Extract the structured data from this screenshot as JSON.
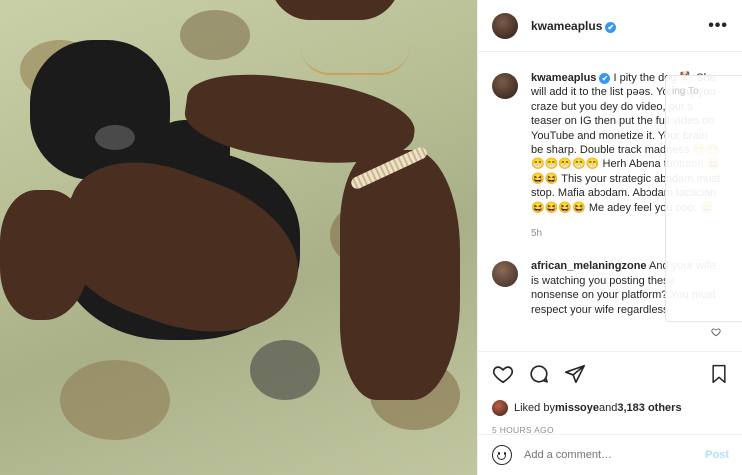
{
  "header": {
    "username": "kwameaplus",
    "verified_glyph": "✔",
    "more_icon": "more-horizontal-icon",
    "more_label": "•••"
  },
  "caption": {
    "username": "kwameaplus",
    "text": " I pity the dog 🐕 She will add it to the list pəəs. You say you craze but you dey do video, put a teaser on IG then put the full video on YouTube and monetize it. Your brain be sharp. Double track madness 😁😁😁😁😁😁😁 Herh Abena tuntum!! 😆😆😆 This your strategic abɔdam must stop. Mafia abɔdam. Abɔdam tactician 😆😆😆😆 Me adey feel you ooo. 😅",
    "time": "5h"
  },
  "comment": {
    "username": "african_melaningzone",
    "text": " And your wife is watching you posting these nonsense on your platform? You must respect your wife regardless"
  },
  "overlay": {
    "ghost_text": "ing To"
  },
  "actions": {
    "like_icon": "heart-icon",
    "comment_icon": "comment-icon",
    "share_icon": "share-icon",
    "save_icon": "bookmark-icon"
  },
  "likes": {
    "prefix": "Liked by ",
    "user": "missoye",
    "middle": " and ",
    "count": "3,183 others"
  },
  "timestamp": "5 HOURS AGO",
  "add_comment": {
    "placeholder": "Add a comment…",
    "post_label": "Post"
  }
}
